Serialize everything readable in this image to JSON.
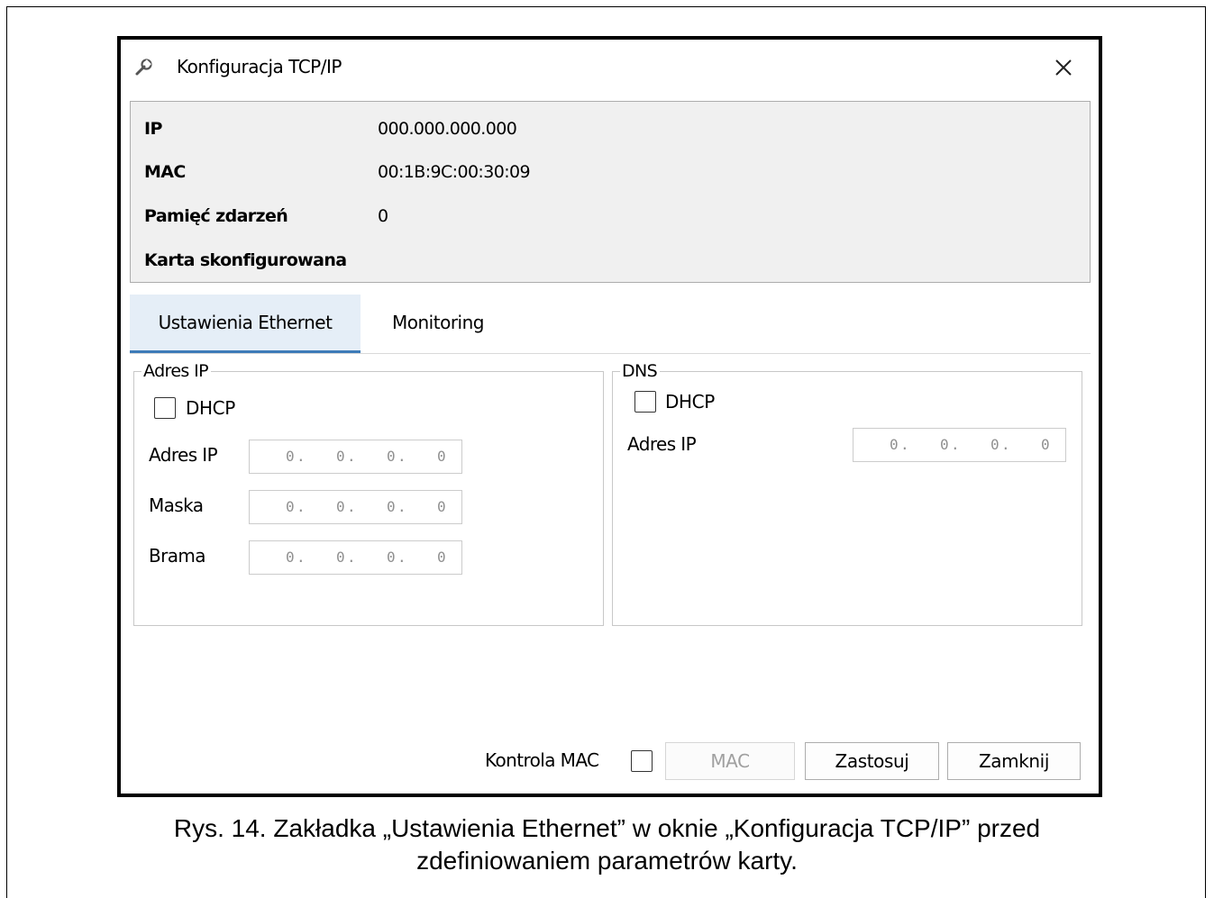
{
  "window": {
    "title": "Konfiguracja TCP/IP",
    "close_icon": "close-icon",
    "app_icon": "wrench-icon"
  },
  "info": {
    "rows": [
      {
        "label": "IP",
        "value": "000.000.000.000"
      },
      {
        "label": "MAC",
        "value": "00:1B:9C:00:30:09"
      },
      {
        "label": "Pamięć zdarzeń",
        "value": "0"
      },
      {
        "label": "Karta skonfigurowana",
        "value": ""
      }
    ]
  },
  "tabs": [
    {
      "label": "Ustawienia Ethernet",
      "active": true
    },
    {
      "label": "Monitoring",
      "active": false
    }
  ],
  "ip_group": {
    "legend": "Adres IP",
    "dhcp_label": "DHCP",
    "dhcp_checked": false,
    "fields": [
      {
        "label": "Adres IP",
        "value": [
          "0",
          "0",
          "0",
          "0"
        ]
      },
      {
        "label": "Maska",
        "value": [
          "0",
          "0",
          "0",
          "0"
        ]
      },
      {
        "label": "Brama",
        "value": [
          "0",
          "0",
          "0",
          "0"
        ]
      }
    ]
  },
  "dns_group": {
    "legend": "DNS",
    "dhcp_label": "DHCP",
    "dhcp_checked": false,
    "fields": [
      {
        "label": "Adres IP",
        "value": [
          "0",
          "0",
          "0",
          "0"
        ]
      }
    ]
  },
  "footer": {
    "mac_control_label": "Kontrola MAC",
    "mac_control_checked": false,
    "mac_button": "MAC",
    "apply_button": "Zastosuj",
    "close_button": "Zamknij"
  },
  "caption": {
    "line1": "Rys. 14. Zakładka „Ustawienia Ethernet” w oknie „Konfiguracja TCP/IP” przed",
    "line2": "zdefiniowaniem parametrów karty."
  },
  "colors": {
    "tab_active_bg": "#e5eef7",
    "tab_active_border": "#3d7bb8",
    "info_bg": "#f0f0f0"
  }
}
